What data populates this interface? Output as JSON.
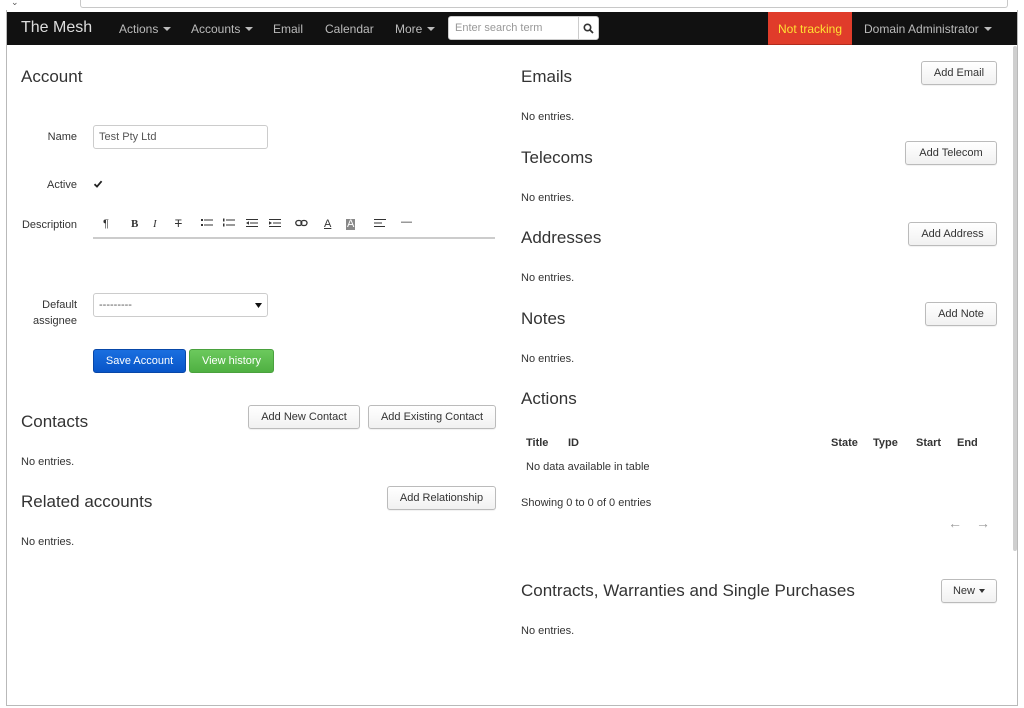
{
  "navbar": {
    "brand": "The Mesh",
    "items": [
      {
        "label": "Actions"
      },
      {
        "label": "Accounts"
      },
      {
        "label": "Email"
      },
      {
        "label": "Calendar"
      },
      {
        "label": "More"
      }
    ],
    "search_placeholder": "Enter search term",
    "tracking_status": "Not tracking",
    "user_menu": "Domain Administrator"
  },
  "account": {
    "title": "Account",
    "name_label": "Name",
    "name_value": "Test Pty Ltd",
    "active_label": "Active",
    "active_checked": true,
    "description_label": "Description",
    "default_assignee_label_1": "Default",
    "default_assignee_label_2": "assignee",
    "default_assignee_value": "---------",
    "save_button": "Save Account",
    "history_button": "View history"
  },
  "contacts": {
    "title": "Contacts",
    "add_new_button": "Add New Contact",
    "add_existing_button": "Add Existing Contact",
    "empty": "No entries."
  },
  "related_accounts": {
    "title": "Related accounts",
    "add_button": "Add Relationship",
    "empty": "No entries."
  },
  "emails": {
    "title": "Emails",
    "add_button": "Add Email",
    "empty": "No entries."
  },
  "telecoms": {
    "title": "Telecoms",
    "add_button": "Add Telecom",
    "empty": "No entries."
  },
  "addresses": {
    "title": "Addresses",
    "add_button": "Add Address",
    "empty": "No entries."
  },
  "notes": {
    "title": "Notes",
    "add_button": "Add Note",
    "empty": "No entries."
  },
  "actions": {
    "title": "Actions",
    "columns": [
      "Title",
      "ID",
      "State",
      "Type",
      "Start",
      "End"
    ],
    "empty": "No data available in table",
    "info": "Showing 0 to 0 of 0 entries",
    "prev": "←",
    "next": "→"
  },
  "contracts": {
    "title": "Contracts, Warranties and Single Purchases",
    "new_button": "New",
    "empty": "No entries."
  },
  "colors": {
    "navbar_bg": "#111111",
    "tracking_bg": "#e03c2a",
    "tracking_text": "#ffe033",
    "primary": "#0855c8",
    "success": "#4fb042"
  }
}
